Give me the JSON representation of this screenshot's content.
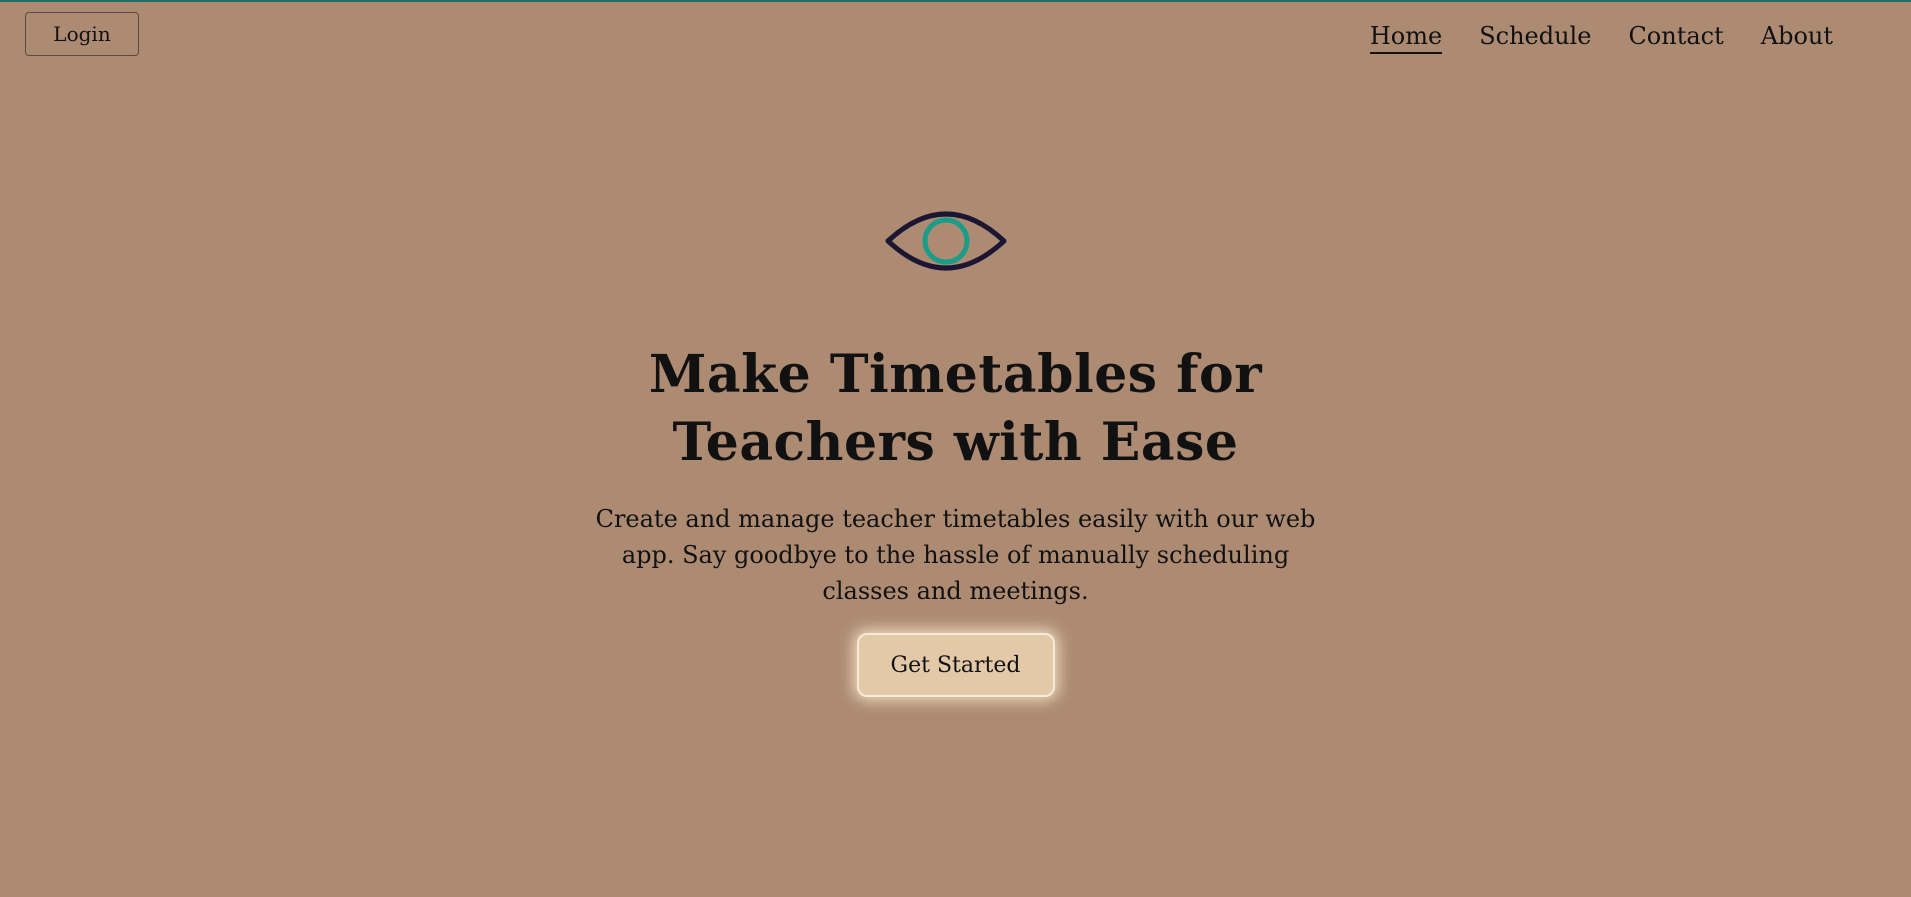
{
  "header": {
    "login_label": "Login",
    "nav": [
      {
        "label": "Home",
        "active": true
      },
      {
        "label": "Schedule",
        "active": false
      },
      {
        "label": "Contact",
        "active": false
      },
      {
        "label": "About",
        "active": false
      }
    ]
  },
  "hero": {
    "icon": "eye-icon",
    "headline": "Make Timetables for Teachers with Ease",
    "subtext": "Create and manage teacher timetables easily with our web app. Say goodbye to the hassle of manually scheduling classes and meetings.",
    "cta_label": "Get Started"
  },
  "colors": {
    "background": "#ad8b73",
    "accent": "#1a9c86",
    "eye_outline": "#1c1633",
    "cta_background": "#e3c9a8"
  }
}
